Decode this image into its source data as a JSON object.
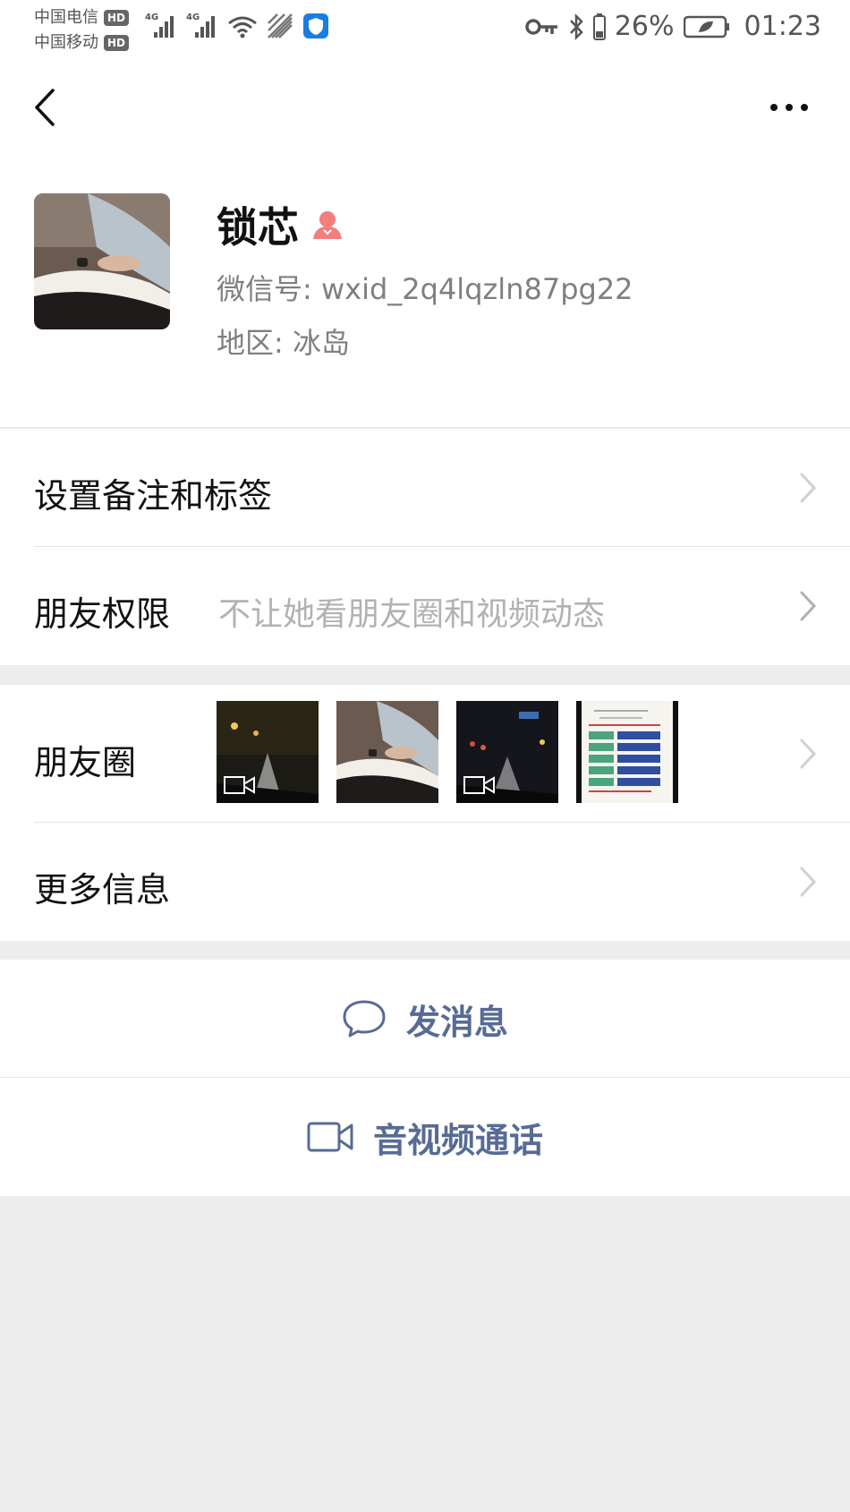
{
  "status_bar": {
    "carrier_1": "中国电信",
    "carrier_2": "中国移动",
    "hd_badge": "HD",
    "network": "4G",
    "battery_percent": "26%",
    "time": "01:23"
  },
  "profile": {
    "name": "锁芯",
    "wechat_id": "微信号: wxid_2q4lqzln87pg22",
    "region": "地区: 冰岛"
  },
  "settings": {
    "remark_label": "设置备注和标签",
    "permission_label": "朋友权限",
    "permission_value": "不让她看朋友圈和视频动态"
  },
  "moments": {
    "label": "朋友圈"
  },
  "more_info": {
    "label": "更多信息"
  },
  "actions": {
    "message_label": "发消息",
    "call_label": "音视频通话"
  },
  "colors": {
    "link_blue": "#576b95",
    "gender_female": "#f37e7d",
    "background": "#ededed"
  }
}
